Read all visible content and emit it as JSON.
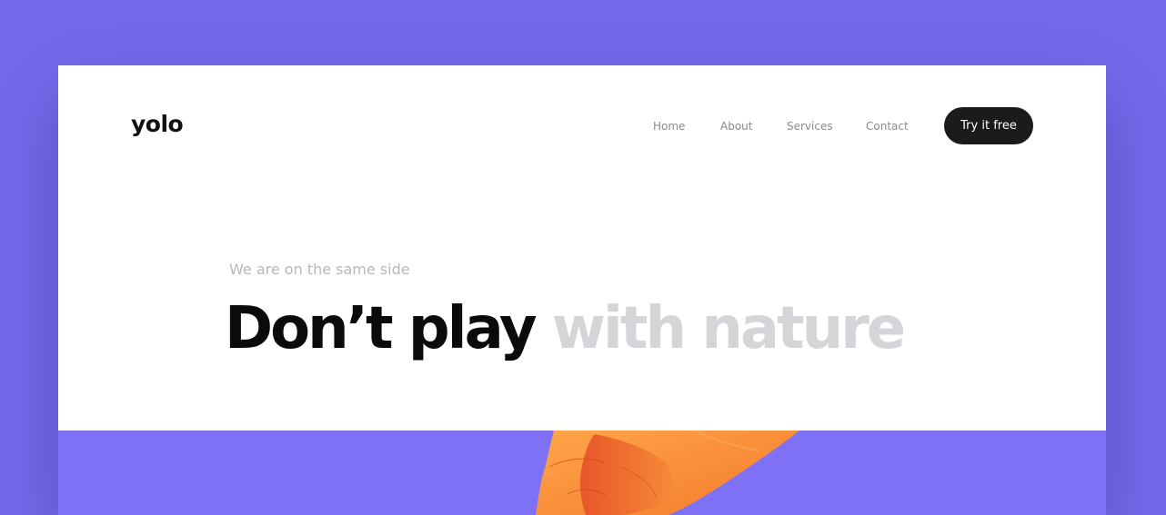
{
  "brand": {
    "logo": "yolo"
  },
  "nav": {
    "items": [
      {
        "label": "Home"
      },
      {
        "label": "About"
      },
      {
        "label": "Services"
      },
      {
        "label": "Contact"
      }
    ],
    "cta_label": "Try it free"
  },
  "hero": {
    "subtitle": "We are on the same side",
    "headline_dark": "Don’t play",
    "headline_light": "with nature"
  },
  "colors": {
    "background": "#766aec",
    "hero_band": "#7e71f6",
    "button": "#1b1b1b",
    "muted_text": "#b7b7bd",
    "headline_light": "#d4d4d9"
  }
}
